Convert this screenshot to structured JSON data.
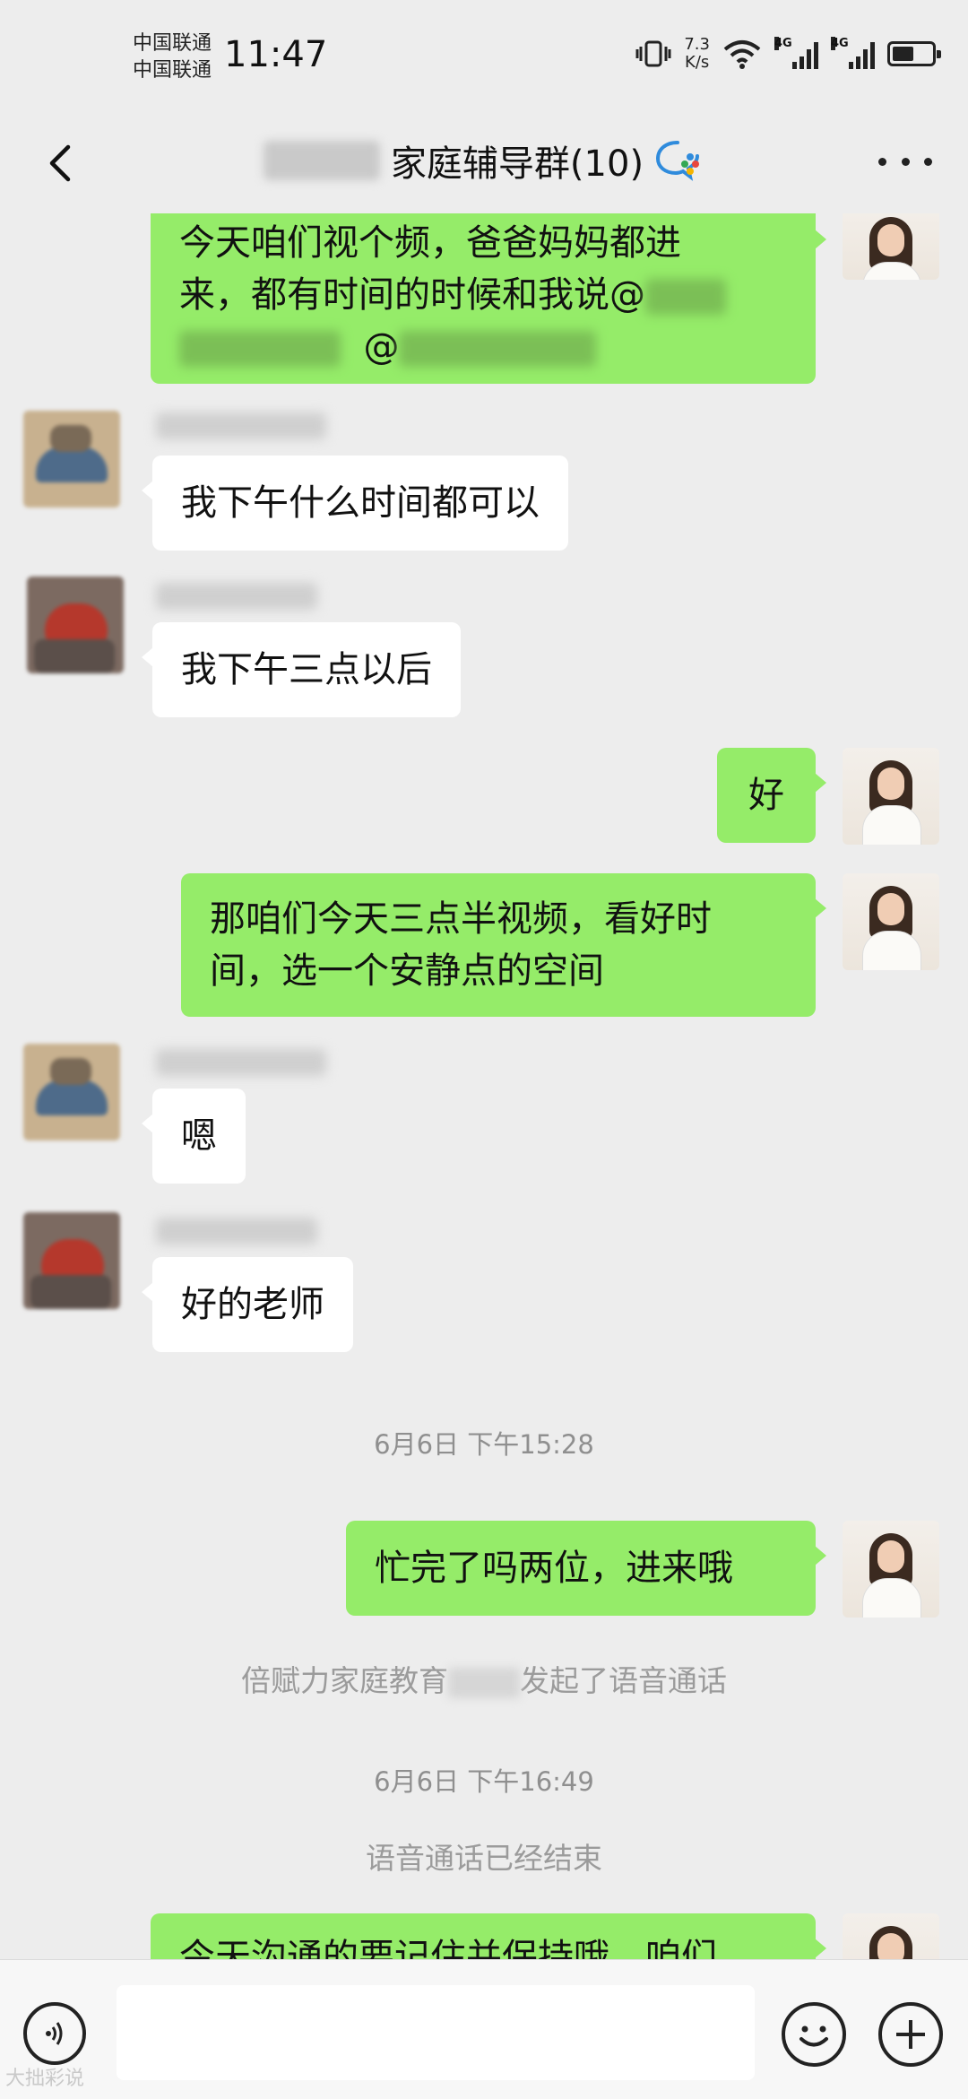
{
  "status_bar": {
    "carrier_1": "中国联通",
    "carrier_2": "中国联通",
    "time": "11:47",
    "speed_value": "7.3",
    "speed_unit": "K/s",
    "network_1": "4G",
    "network_2": "4G",
    "battery_level": 0.55
  },
  "nav": {
    "title": "家庭辅导群(10)"
  },
  "messages": {
    "m1_line1": "今天咱们视个频，爸爸妈妈都进",
    "m1_line2": "来，都有时间的时候和我说@",
    "m1_at": "@",
    "m2": "我下午什么时间都可以",
    "m3": "我下午三点以后",
    "m4": "好",
    "m5_line1": "那咱们今天三点半视频，看好时",
    "m5_line2": "间，选一个安静点的空间",
    "m6": "嗯",
    "m7": "好的老师",
    "time1": "6月6日 下午15:28",
    "m8": "忙完了吗两位，进来哦",
    "sys1_prefix": "倍赋力家庭教育",
    "sys1_suffix": "发起了语音通话",
    "time2": "6月6日 下午16:49",
    "sys2": "语音通话已经结束",
    "m9_partial": "今天沟通的要记住并保持哦，咱们"
  },
  "input": {
    "value": ""
  },
  "watermark": "大拙彩说",
  "colors": {
    "sent_bubble": "#95ec69",
    "received_bubble": "#ffffff",
    "background": "#ededed"
  }
}
